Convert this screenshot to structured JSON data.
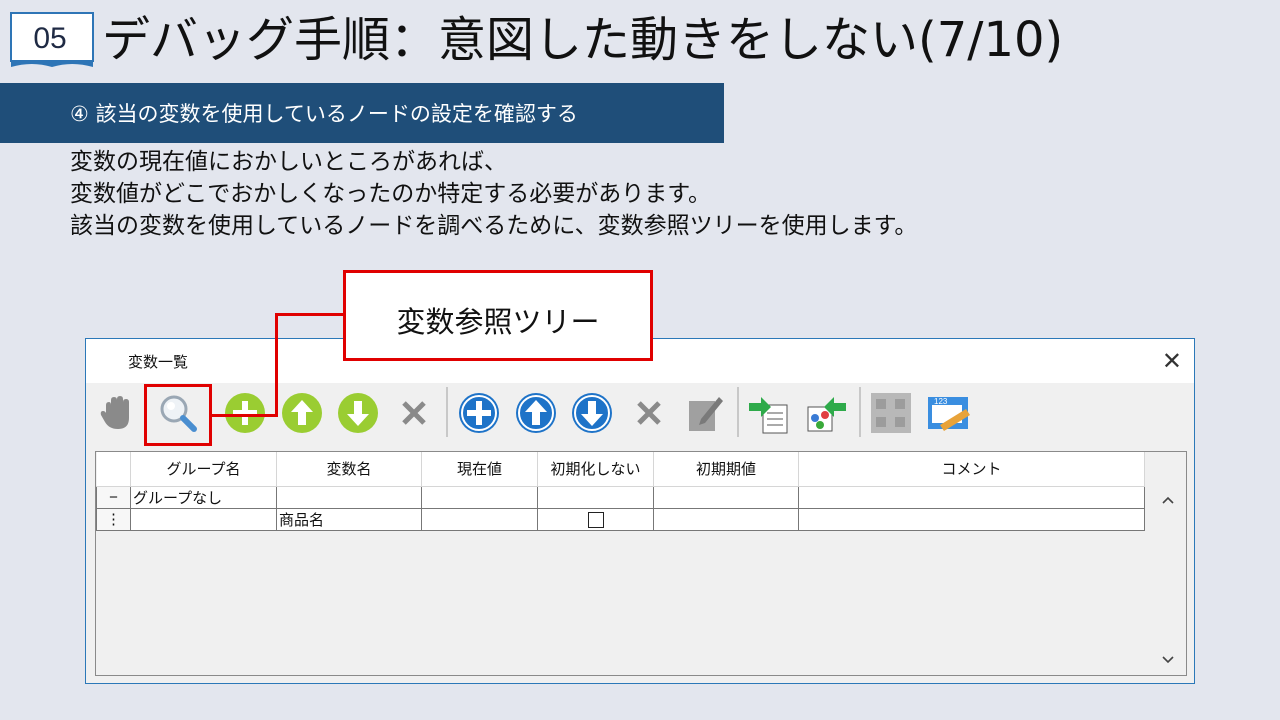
{
  "slide": {
    "number": "05",
    "title": "デバッグ手順：意図した動きをしない(7/10)",
    "subheading": "④ 該当の変数を使用しているノードの設定を確認する",
    "body_lines": [
      "変数の現在値におかしいところがあれば、",
      "変数値がどこでおかしくなったのか特定する必要があります。",
      "該当の変数を使用しているノードを調べるために、変数参照ツリーを使用します。"
    ],
    "callout": "変数参照ツリー"
  },
  "dialog": {
    "title": "変数一覧",
    "close": "✕",
    "toolbar": [
      {
        "name": "hand-icon"
      },
      {
        "name": "variable-reference-tree-icon"
      },
      {
        "name": "add-group-icon"
      },
      {
        "name": "move-group-up-icon"
      },
      {
        "name": "move-group-down-icon"
      },
      {
        "name": "delete-group-icon"
      },
      {
        "name": "add-variable-icon"
      },
      {
        "name": "move-variable-up-icon"
      },
      {
        "name": "move-variable-down-icon"
      },
      {
        "name": "delete-variable-icon"
      },
      {
        "name": "edit-icon"
      },
      {
        "name": "import-icon"
      },
      {
        "name": "export-icon"
      },
      {
        "name": "disabled-tree-icon"
      },
      {
        "name": "numbering-icon"
      }
    ],
    "columns": [
      "",
      "グループ名",
      "変数名",
      "現在値",
      "初期化しない",
      "初期期値",
      "コメント"
    ],
    "rows": [
      {
        "marker": "−",
        "group": "グループなし",
        "variable": "",
        "current": "",
        "no_init": false,
        "initial": "",
        "comment": ""
      },
      {
        "marker": "⋮",
        "group": "",
        "variable": "商品名",
        "current": "",
        "no_init": true,
        "initial": "",
        "comment": ""
      }
    ],
    "scroll_up": "^",
    "scroll_down": "v"
  }
}
